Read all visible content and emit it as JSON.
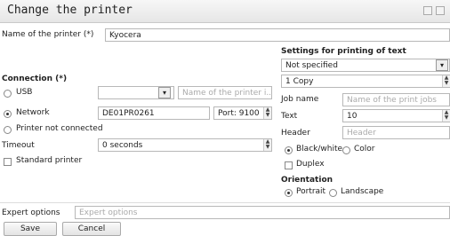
{
  "window": {
    "title": "Change the printer"
  },
  "name": {
    "label": "Name of the printer (*)",
    "value": "Kyocera"
  },
  "connection": {
    "heading": "Connection (*)",
    "usb_label": "USB",
    "usb_printer_placeholder": "Name of the printer i...",
    "network_label": "Network",
    "network_value": "DE01PR0261",
    "port_value": "Port: 9100",
    "not_connected_label": "Printer  not connected",
    "timeout_label": "Timeout",
    "timeout_value": "0 seconds",
    "standard_printer_label": "Standard printer",
    "selected": "Network"
  },
  "settings": {
    "heading": "Settings for printing of text",
    "paper_value": "Not specified",
    "copies_value": "1 Copy",
    "job_label": "Job name",
    "job_placeholder": "Name of the print jobs",
    "text_label": "Text",
    "text_value": "10",
    "header_label": "Header",
    "header_placeholder": "Header",
    "bw_label": "Black/white",
    "color_label": "Color",
    "duplex_label": "Duplex",
    "orientation_heading": "Orientation",
    "portrait_label": "Portrait",
    "landscape_label": "Landscape"
  },
  "expert": {
    "label": "Expert options",
    "placeholder": "Expert options"
  },
  "buttons": {
    "save": "Save",
    "cancel": "Cancel"
  }
}
